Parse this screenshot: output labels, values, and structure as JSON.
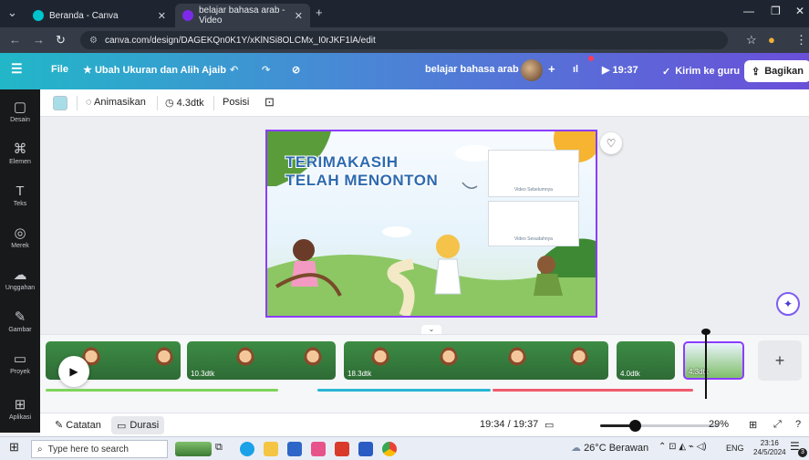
{
  "browser": {
    "tabs": [
      {
        "title": "Beranda - Canva"
      },
      {
        "title": "belajar bahasa arab - Video"
      }
    ],
    "new_tab": "+",
    "url": "canva.com/design/DAGEKQn0K1Y/xKlNSi8OLCMx_I0rJKF1lA/edit"
  },
  "canva_bar": {
    "menu_icon": "☰",
    "file": "File",
    "resize": "Ubah Ukuran dan Alih Ajaib",
    "design_name": "belajar bahasa arab",
    "add_member": "+",
    "timer": "19:37",
    "send_teacher": "Kirim ke guru",
    "share": "Bagikan"
  },
  "sidebar": {
    "items": [
      {
        "label": "Desain",
        "icon": "▢"
      },
      {
        "label": "Elemen",
        "icon": "⌘"
      },
      {
        "label": "Teks",
        "icon": "T"
      },
      {
        "label": "Merek",
        "icon": "◎"
      },
      {
        "label": "Unggahan",
        "icon": "☁"
      },
      {
        "label": "Gambar",
        "icon": "✎"
      },
      {
        "label": "Proyek",
        "icon": "▭"
      },
      {
        "label": "Aplikasi",
        "icon": "⊞"
      }
    ]
  },
  "toolbar": {
    "animate": "Animasikan",
    "duration": "4.3dtk",
    "position": "Posisi",
    "swatch_color": "#a8dde8"
  },
  "slide": {
    "title_line1": "TERIMAKASIH",
    "title_line2": "TELAH MENONTON",
    "video_prev": "Video Sebelumnya",
    "video_next": "Video Sesudahnya"
  },
  "timeline": {
    "clips": [
      {
        "duration": ""
      },
      {
        "duration": "10.3dtk"
      },
      {
        "duration": "18.3dtk"
      },
      {
        "duration": ""
      },
      {
        "duration": "4.0dtk"
      },
      {
        "duration": "4.3dtk"
      }
    ],
    "add_page": "+"
  },
  "bottom_bar": {
    "notes": "Catatan",
    "duration": "Durasi",
    "time": "19:34 / 19:37",
    "zoom": "29%",
    "zoom_fraction": 0.29
  },
  "taskbar": {
    "search_placeholder": "Type here to search",
    "weather": "26°C  Berawan",
    "language": "ENG",
    "time": "23:16",
    "date": "24/5/2024",
    "notification_count": "3"
  },
  "colors": {
    "accent": "#8b3dff",
    "sidebar_bg": "#18191b",
    "browser_bg": "#1f2530"
  }
}
